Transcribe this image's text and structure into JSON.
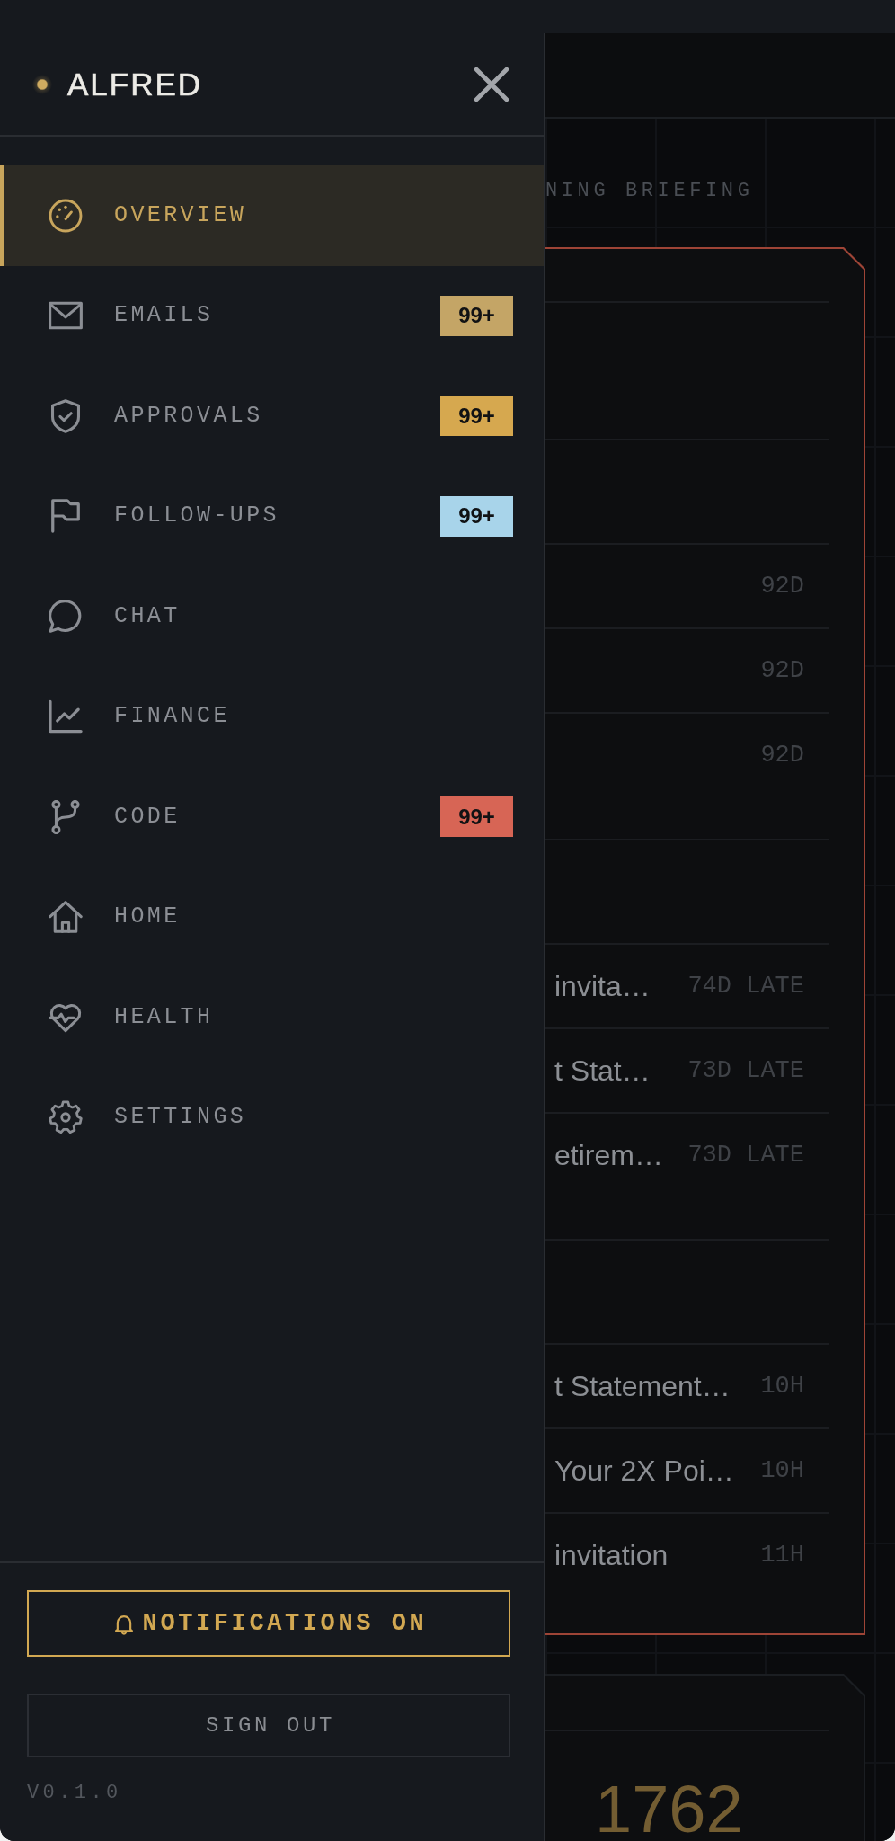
{
  "drawer": {
    "brand": "ALFRED",
    "nav_items": [
      {
        "label": "OVERVIEW",
        "selected": true
      },
      {
        "label": "EMAILS",
        "selected": false,
        "badge": "99+",
        "color": "#c4a566"
      },
      {
        "label": "APPROVALS",
        "selected": false,
        "badge": "99+",
        "color": "#d6a84f"
      },
      {
        "label": "FOLLOW-UPS",
        "selected": false,
        "badge": "99+",
        "color": "#a8d4ea"
      },
      {
        "label": "CHAT",
        "selected": false
      },
      {
        "label": "FINANCE",
        "selected": false
      },
      {
        "label": "CODE",
        "selected": false,
        "badge": "99+",
        "color": "#d76555"
      },
      {
        "label": "HOME",
        "selected": false
      },
      {
        "label": "HEALTH",
        "selected": false
      },
      {
        "label": "SETTINGS",
        "selected": false
      }
    ],
    "notifications": {
      "label": "NOTIFICATIONS ON",
      "on": true
    },
    "sign_out": {
      "label": "SIGN OUT"
    },
    "version": "V0.1.0"
  },
  "main": {
    "section_title": "NING BRIEFING",
    "briefing_card": {
      "sections": [
        {
          "rows": [
            {
              "age": "92D"
            },
            {
              "age": "92D"
            },
            {
              "age": "92D"
            }
          ]
        },
        {
          "rows": [
            {
              "title": "invita…",
              "age": "74D LATE"
            },
            {
              "title": "t Stat…",
              "age": "73D LATE"
            },
            {
              "title": "etirem…",
              "age": "73D LATE"
            }
          ]
        },
        {
          "rows": [
            {
              "title": "t Statement…",
              "age": "10H"
            },
            {
              "title": "Your 2X Poi…",
              "age": "10H"
            },
            {
              "title": "invitation",
              "age": "11H"
            }
          ]
        }
      ]
    },
    "stat_card": {
      "value": "1762"
    }
  }
}
